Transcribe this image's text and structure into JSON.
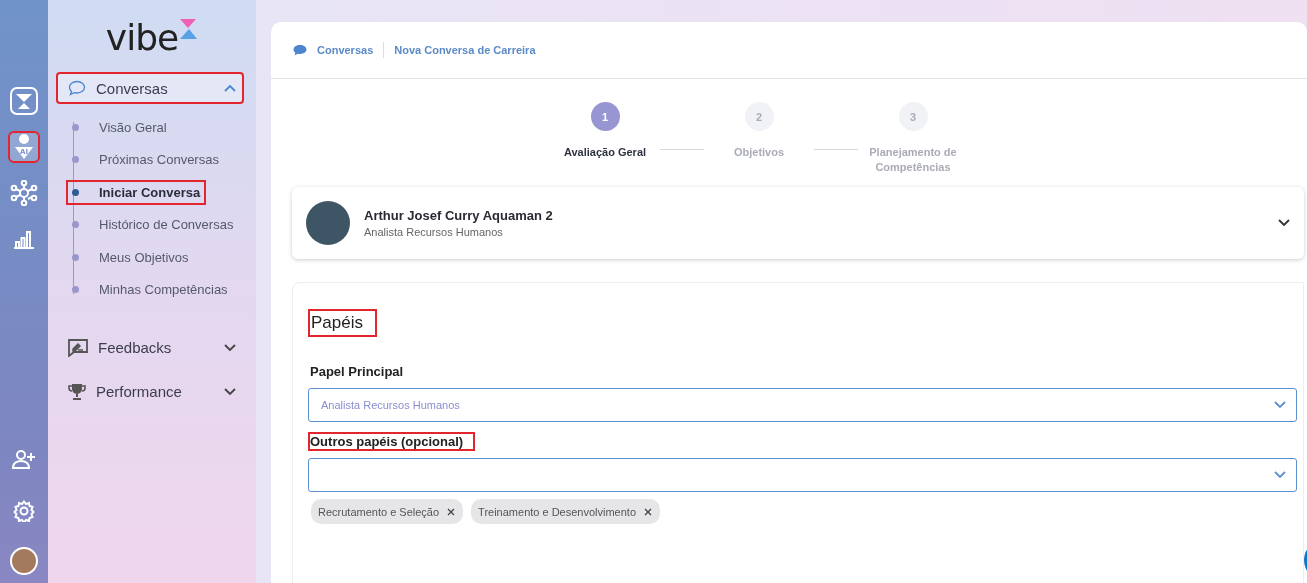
{
  "rail": {
    "top": [
      {
        "kind": "logo",
        "selected": false,
        "highlighted": false
      },
      {
        "kind": "ai",
        "badge": "AI",
        "selected": true,
        "highlighted": true
      },
      {
        "kind": "network",
        "selected": false,
        "highlighted": false
      },
      {
        "kind": "chart",
        "selected": false,
        "highlighted": false
      }
    ],
    "bottom": [
      {
        "kind": "add-user"
      },
      {
        "kind": "settings"
      },
      {
        "kind": "avatar"
      }
    ]
  },
  "sidebar": {
    "logo": "vibe",
    "groups": [
      {
        "label": "Conversas",
        "expanded": true,
        "highlighted": true,
        "items": [
          {
            "label": "Visão Geral",
            "selected": false,
            "highlighted": false
          },
          {
            "label": "Próximas Conversas",
            "selected": false,
            "highlighted": false
          },
          {
            "label": "Iniciar Conversa",
            "selected": true,
            "highlighted": true
          },
          {
            "label": "Histórico de Conversas",
            "selected": false,
            "highlighted": false
          },
          {
            "label": "Meus Objetivos",
            "selected": false,
            "highlighted": false
          },
          {
            "label": "Minhas Competências",
            "selected": false,
            "highlighted": false
          }
        ]
      },
      {
        "label": "Feedbacks",
        "expanded": false,
        "highlighted": false
      },
      {
        "label": "Performance",
        "expanded": false,
        "highlighted": false
      }
    ]
  },
  "breadcrumb": [
    {
      "label": "Conversas"
    },
    {
      "label": "Nova Conversa de Carreira"
    }
  ],
  "stepper": [
    {
      "number": "1",
      "label": "Avaliação Geral",
      "selected": true
    },
    {
      "number": "2",
      "label": "Objetivos",
      "selected": false
    },
    {
      "number": "3",
      "label": "Planejamento de Competências",
      "selected": false
    }
  ],
  "profile": {
    "name": "Arthur Josef Curry Aquaman 2",
    "role": "Analista Recursos Humanos",
    "expanded": false
  },
  "roles": {
    "title": "Papéis",
    "title_highlighted": true,
    "primary": {
      "label": "Papel Principal",
      "value": "Analista Recursos Humanos",
      "highlighted": false
    },
    "others": {
      "label": "Outros papéis (opcional)",
      "highlighted": true,
      "tags": [
        "Recrutamento e Seleção",
        "Treinamento e Desenvolvimento"
      ]
    }
  }
}
